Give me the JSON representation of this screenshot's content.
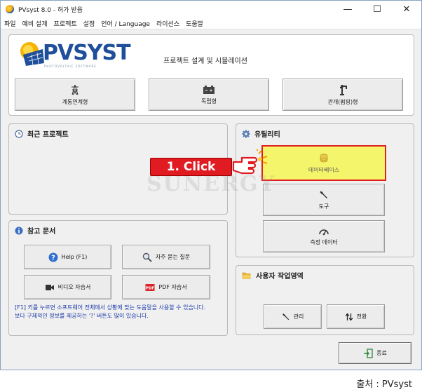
{
  "window": {
    "title": "PVsyst 8.0 - 허가 받음",
    "controls": {
      "minimize": "—",
      "maximize": "☐",
      "close": "✕"
    }
  },
  "menu": [
    "파일",
    "예비 설계",
    "프로젝트",
    "설정",
    "언어 / Language",
    "라이선스",
    "도움말"
  ],
  "header": {
    "logo": "PVSYST",
    "logo_sub": "PHOTOVOLTAIC SOFTWARE",
    "subtitle": "프로젝트 설계 및 시뮬레이션",
    "buttons": [
      "계통연계형",
      "독립형",
      "관개(펌핑)형"
    ]
  },
  "recent": {
    "title": "최근 프로젝트"
  },
  "utilities": {
    "title": "유틸리티",
    "database": "데이터베이스",
    "tools": "도구",
    "measured": "측정 데이터"
  },
  "reference": {
    "title": "참고 문서",
    "help": "Help (F1)",
    "faq": "자주 묻는 질문",
    "video": "비디오 자습서",
    "pdf": "PDF 자습서",
    "note_line1": "[F1] 키를 누르면 소프트웨어 전체에서 상황에 맞는 도움말을 사용할 수 있습니다.",
    "note_line2": "보다 구체적인 정보를 제공하는 '?' 버튼도 많이 있습니다."
  },
  "workspace": {
    "title": "사용자 작업영역",
    "manage": "관리",
    "switch": "전환"
  },
  "exit": "종료",
  "annotation": {
    "click_label": "1. Click",
    "watermark": "SUNERGY"
  },
  "source": "출처 : PVsyst",
  "colors": {
    "highlight": "#f5f56b",
    "callout": "#e11b22",
    "logo_blue": "#1f4f9a"
  }
}
